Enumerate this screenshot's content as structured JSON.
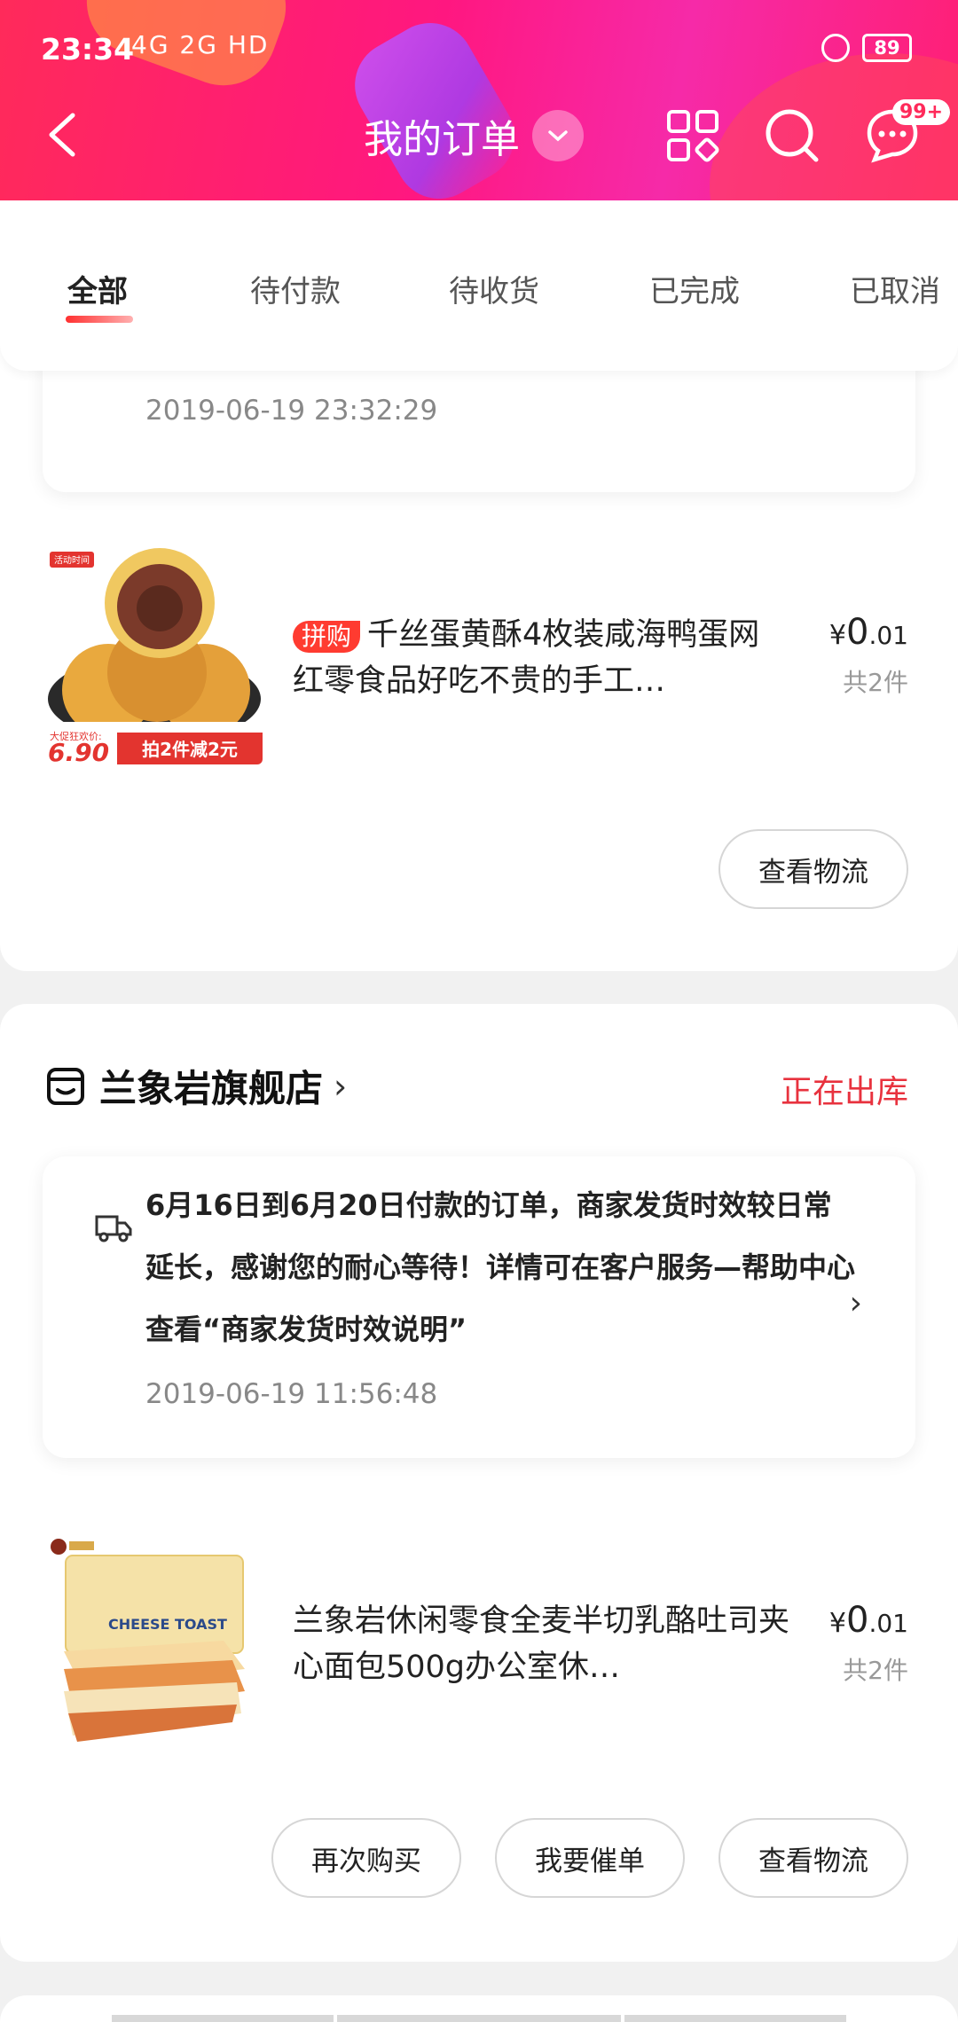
{
  "status_bar": {
    "time": "23:34",
    "signal_text": "4G 2G HD",
    "battery": "89"
  },
  "header": {
    "title": "我的订单",
    "badge": "99+"
  },
  "tabs": [
    {
      "label": "全部",
      "active": true
    },
    {
      "label": "待付款",
      "active": false
    },
    {
      "label": "待收货",
      "active": false
    },
    {
      "label": "已完成",
      "active": false
    },
    {
      "label": "已取消",
      "active": false
    }
  ],
  "order1": {
    "notice_time": "2019-06-19 23:32:29",
    "product": {
      "tag": "拼购",
      "name": "千丝蛋黄酥4枚装咸海鸭蛋网红零食品好吃不贵的手工…",
      "price_symbol": "¥",
      "price_int": "0",
      "price_dec": ".01",
      "qty": "共2件",
      "image_badge_top": "活动时间",
      "image_price": "6.90",
      "image_promo": "拍2件减2元",
      "image_label": "大促狂欢价:"
    },
    "buttons": {
      "logistics": "查看物流"
    }
  },
  "order2": {
    "shop_name": "兰象岩旗舰店",
    "status": "正在出库",
    "notice_text": "6月16日到6月20日付款的订单，商家发货时效较日常延长，感谢您的耐心等待！详情可在客户服务—帮助中心查看“商家发货时效说明”",
    "notice_time": "2019-06-19 11:56:48",
    "product": {
      "name": "兰象岩休闲零食全麦半切乳酪吐司夹心面包500g办公室休…",
      "price_symbol": "¥",
      "price_int": "0",
      "price_dec": ".01",
      "qty": "共2件",
      "image_text": "CHEESE TOAST"
    },
    "buttons": {
      "buy_again": "再次购买",
      "urge": "我要催单",
      "logistics": "查看物流"
    }
  },
  "colors": {
    "accent": "#ff1f73",
    "status_red": "#e8323e",
    "tag_red": "#ff3b30"
  },
  "icons": [
    "back-icon",
    "dropdown-icon",
    "grid-icon",
    "search-icon",
    "message-icon",
    "truck-icon",
    "shop-icon",
    "chevron-right-icon"
  ]
}
